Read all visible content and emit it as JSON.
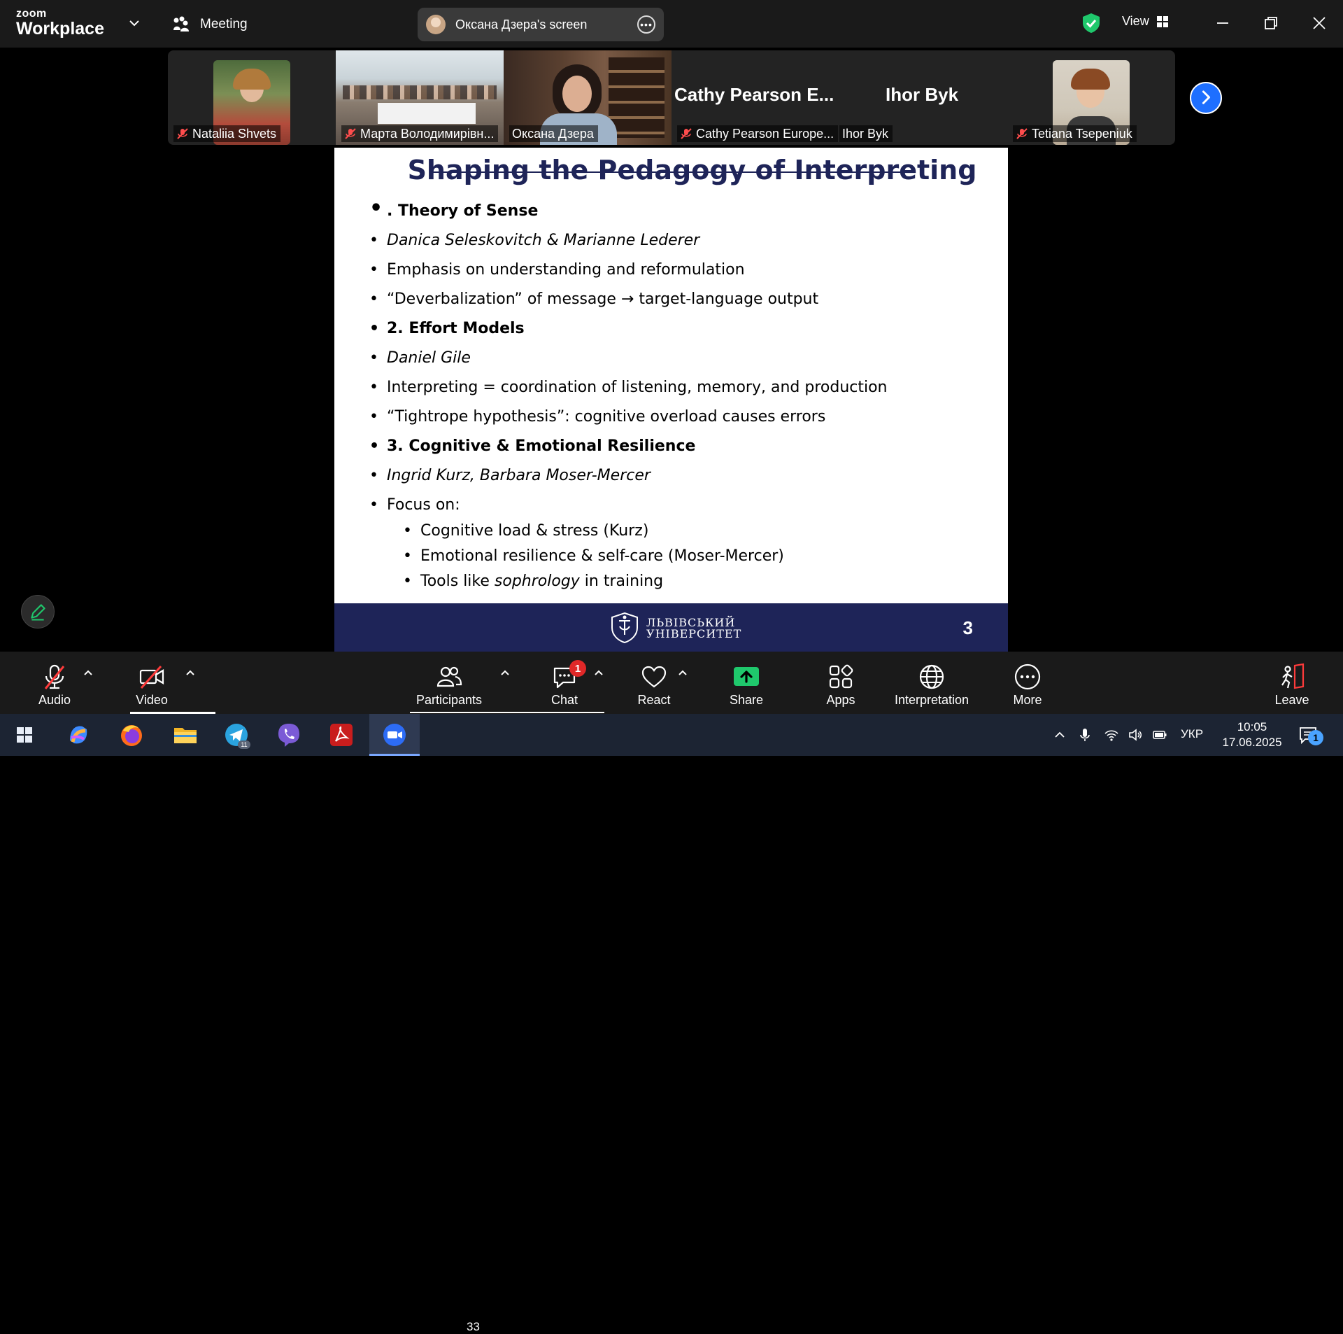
{
  "app": {
    "logo_top": "zoom",
    "logo_bottom": "Workplace"
  },
  "header": {
    "meeting_label": "Meeting",
    "screen_share_label": "Оксана Дзера's screen",
    "view_label": "View"
  },
  "gallery": {
    "tiles": [
      {
        "name": "Nataliia Shvets",
        "muted": true
      },
      {
        "name": "Марта Володимирівн...",
        "muted": true
      },
      {
        "name": "Оксана Дзера",
        "muted": false,
        "active": true
      },
      {
        "name": "Cathy Pearson Europe...",
        "big_name": "Cathy  Pearson  E...",
        "muted": true
      },
      {
        "name": "Ihor Byk",
        "big_name": "Ihor Byk",
        "muted": false
      },
      {
        "name": "Tetiana Tsepeniuk",
        "muted": true
      }
    ]
  },
  "slide": {
    "title": "Shaping the Pedagogy of Interpreting",
    "bullets": [
      {
        "text": ". Theory of Sense",
        "style": "bold"
      },
      {
        "text": "Danica Seleskovitch & Marianne Lederer",
        "style": "italic"
      },
      {
        "text": "Emphasis on understanding and reformulation",
        "style": "normal"
      },
      {
        "text": "“Deverbalization” of message → target-language output",
        "style": "normal"
      },
      {
        "text": "2. Effort Models",
        "style": "bold"
      },
      {
        "text": "Daniel Gile",
        "style": "italic"
      },
      {
        "text": "Interpreting = coordination of listening, memory, and production",
        "style": "normal"
      },
      {
        "text": "“Tightrope hypothesis”: cognitive overload causes errors",
        "style": "normal"
      },
      {
        "text": "3. Cognitive & Emotional Resilience",
        "style": "bold"
      },
      {
        "text": "Ingrid Kurz, Barbara Moser-Mercer",
        "style": "italic"
      },
      {
        "text": "Focus on:",
        "style": "normal"
      }
    ],
    "sub_bullets": [
      "Cognitive load & stress (Kurz)",
      "Emotional resilience & self-care (Moser-Mercer)"
    ],
    "last_sub": {
      "before": "Tools like ",
      "italic": "sophrology",
      "after": " in training"
    },
    "university_line1": "ЛЬВІВСЬКИЙ",
    "university_line2": "УНІВЕРСИТЕТ",
    "page_number": "3"
  },
  "toolbar": {
    "audio": "Audio",
    "video": "Video",
    "participants": "Participants",
    "participants_count": "33",
    "chat": "Chat",
    "chat_badge": "1",
    "react": "React",
    "share": "Share",
    "apps": "Apps",
    "interpretation": "Interpretation",
    "more": "More",
    "leave": "Leave"
  },
  "taskbar": {
    "telegram_badge": "11",
    "language": "УКР",
    "time": "10:05",
    "date": "17.06.2025",
    "notifications": "1"
  },
  "colors": {
    "accent_green": "#1fc86c",
    "accent_blue": "#1e6fff",
    "slide_navy": "#1e2458",
    "badge_red": "#e02828"
  }
}
